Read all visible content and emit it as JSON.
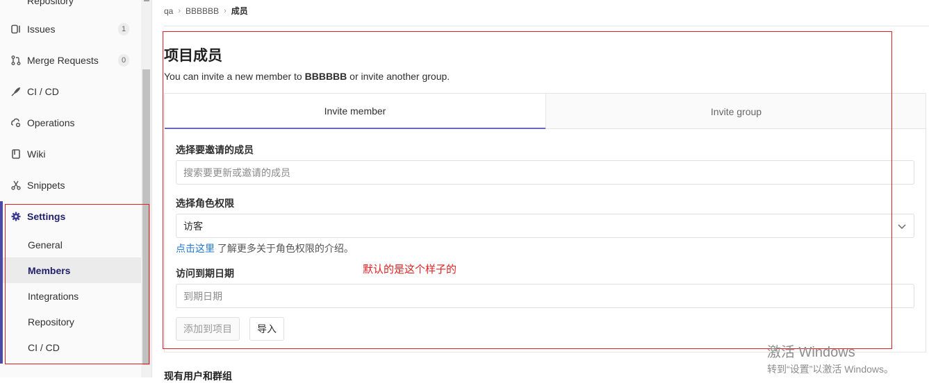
{
  "sidebar": {
    "top_partial_label": "Repository",
    "items": [
      {
        "label": "Issues",
        "badge": "1"
      },
      {
        "label": "Merge Requests",
        "badge": "0"
      },
      {
        "label": "CI / CD"
      },
      {
        "label": "Operations"
      },
      {
        "label": "Wiki"
      },
      {
        "label": "Snippets"
      },
      {
        "label": "Settings"
      }
    ],
    "settings_sub": [
      "General",
      "Members",
      "Integrations",
      "Repository",
      "CI / CD"
    ]
  },
  "breadcrumb": {
    "items": [
      "qa",
      "BBBBBB",
      "成员"
    ]
  },
  "page": {
    "title": "项目成员",
    "desc_prefix": "You can invite a new member to ",
    "desc_project": "BBBBBB",
    "desc_suffix": " or invite another group."
  },
  "tabs": {
    "invite_member": "Invite member",
    "invite_group": "Invite group"
  },
  "form": {
    "member_label": "选择要邀请的成员",
    "member_placeholder": "搜索要更新或邀请的成员",
    "role_label": "选择角色权限",
    "role_value": "访客",
    "hint_link": "点击这里",
    "hint_text": " 了解更多关于角色权限的介绍。",
    "expire_label": "访问到期日期",
    "expire_placeholder": "到期日期",
    "add_button": "添加到项目",
    "import_button": "导入"
  },
  "annotation": {
    "note": "默认的是这个样子的"
  },
  "section2_title": "现有用户和群组",
  "watermark": {
    "line1": "激活 Windows",
    "line2": "转到“设置”以激活 Windows。"
  },
  "colors": {
    "accent": "#6666c4",
    "annotation": "#e02020",
    "link": "#1f78d1"
  }
}
